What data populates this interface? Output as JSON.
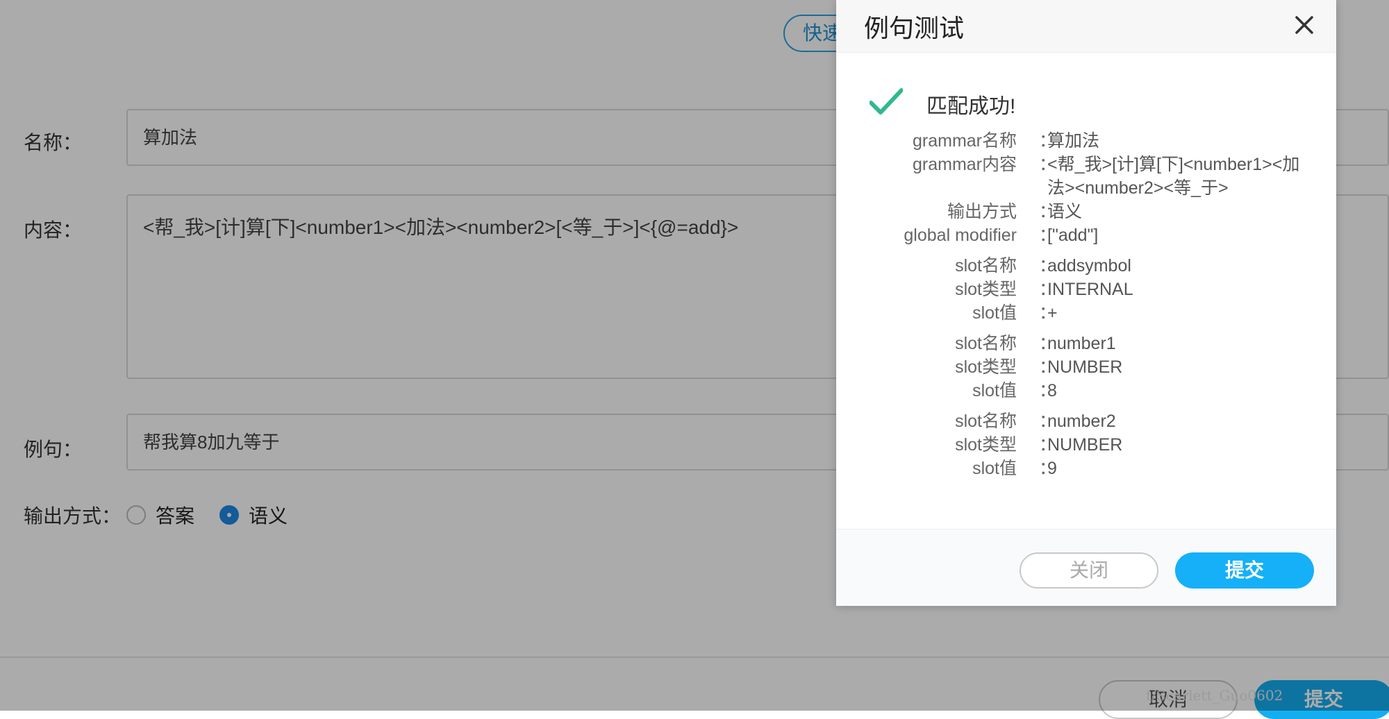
{
  "background_form": {
    "quick_button_label": "快速",
    "name_label": "名称：",
    "name_value": "算加法",
    "content_label": "内容：",
    "content_value": "<帮_我>[计]算[下]<number1><加法><number2>[<等_于>]<{@=add}>",
    "example_label": "例句：",
    "example_value": "帮我算8加九等于",
    "output_label": "输出方式：",
    "output_options": [
      {
        "label": "答案",
        "checked": false
      },
      {
        "label": "语义",
        "checked": true
      }
    ],
    "cancel_label": "取消",
    "submit_label": "提交",
    "watermark": "t/Scarlett_Guo0602"
  },
  "modal": {
    "title": "例句测试",
    "success_text": "匹配成功!",
    "fields": [
      {
        "key": "grammar名称",
        "value": "算加法"
      },
      {
        "key": "grammar内容",
        "value": "<帮_我>[计]算[下]<number1><加法><number2><等_于>"
      },
      {
        "key": "输出方式",
        "value": "语义"
      },
      {
        "key": "global modifier",
        "value": "[\"add\"]"
      }
    ],
    "slots": [
      {
        "name_key": "slot名称",
        "name": "addsymbol",
        "type_key": "slot类型",
        "type": "INTERNAL",
        "value_key": "slot值",
        "value": "+"
      },
      {
        "name_key": "slot名称",
        "name": "number1",
        "type_key": "slot类型",
        "type": "NUMBER",
        "value_key": "slot值",
        "value": "8"
      },
      {
        "name_key": "slot名称",
        "name": "number2",
        "type_key": "slot类型",
        "type": "NUMBER",
        "value_key": "slot值",
        "value": "9"
      }
    ],
    "separator": "：",
    "close_label": "关闭",
    "submit_label": "提交"
  },
  "colors": {
    "accent": "#15b0f8",
    "success_check": "#2fb98f",
    "overlay": "rgba(0,0,0,0.33)"
  },
  "icons": {
    "close": "close-icon",
    "success": "check-icon"
  }
}
